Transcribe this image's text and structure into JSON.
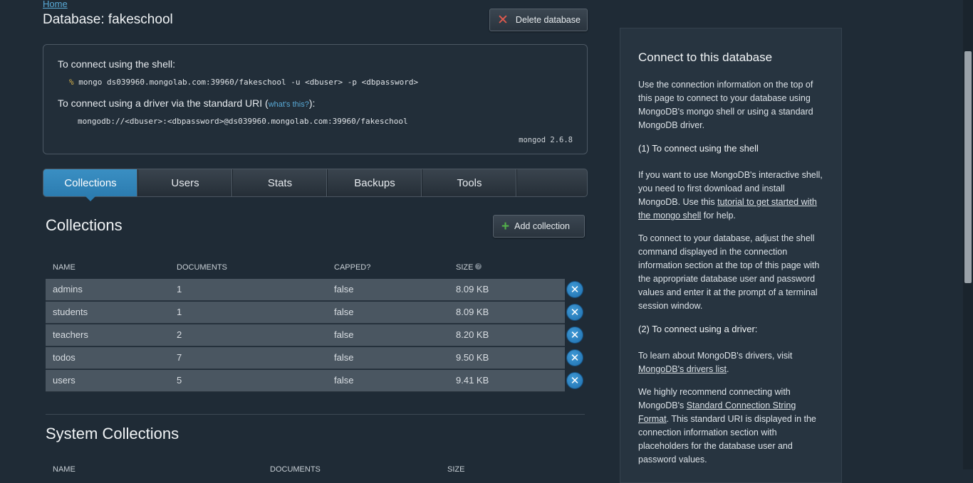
{
  "breadcrumb": {
    "home": "Home"
  },
  "page_title": "Database: fakeschool",
  "delete_database": {
    "label": "Delete database"
  },
  "connect_box": {
    "shell_heading": "To connect using the shell:",
    "shell_prompt": "%",
    "shell_command": "mongo ds039960.mongolab.com:39960/fakeschool -u <dbuser> -p <dbpassword>",
    "driver_heading_pre": "To connect using a driver via the standard URI (",
    "driver_link": "what's this?",
    "driver_heading_post": "):",
    "uri": "mongodb://<dbuser>:<dbpassword>@ds039960.mongolab.com:39960/fakeschool",
    "version": "mongod 2.6.8"
  },
  "tabs": [
    "Collections",
    "Users",
    "Stats",
    "Backups",
    "Tools"
  ],
  "active_tab": "Collections",
  "collections": {
    "heading": "Collections",
    "add_label": "Add collection",
    "columns": {
      "name": "NAME",
      "documents": "DOCUMENTS",
      "capped": "CAPPED?",
      "size": "SIZE"
    },
    "rows": [
      {
        "name": "admins",
        "documents": "1",
        "capped": "false",
        "size": "8.09 KB"
      },
      {
        "name": "students",
        "documents": "1",
        "capped": "false",
        "size": "8.09 KB"
      },
      {
        "name": "teachers",
        "documents": "2",
        "capped": "false",
        "size": "8.20 KB"
      },
      {
        "name": "todos",
        "documents": "7",
        "capped": "false",
        "size": "9.50 KB"
      },
      {
        "name": "users",
        "documents": "5",
        "capped": "false",
        "size": "9.41 KB"
      }
    ]
  },
  "system_collections": {
    "heading": "System Collections",
    "columns": {
      "name": "NAME",
      "documents": "DOCUMENTS",
      "size": "SIZE"
    }
  },
  "help_panel": {
    "title": "Connect to this database",
    "intro_pre": "Use the connection information on the top of this page to connect to your database using MongoDB's ",
    "intro_code": "mongo",
    "intro_post": " shell or using a standard MongoDB driver.",
    "shell_heading": "(1) To connect using the shell",
    "shell_p1_pre": "If you want to use MongoDB's interactive shell, you need to first download and install MongoDB. Use this ",
    "shell_p1_link": "tutorial to get started with the mongo shell",
    "shell_p1_post": " for help.",
    "shell_p2": "To connect to your database, adjust the shell command displayed in the connection information section at the top of this page with the appropriate database user and password values and enter it at the prompt of a terminal session window.",
    "driver_heading": "(2) To connect using a driver:",
    "driver_p1_pre": "To learn about MongoDB's drivers, visit ",
    "driver_p1_link": "MongoDB's drivers list",
    "driver_p1_post": ".",
    "driver_p2_pre": "We highly recommend connecting with MongoDB's ",
    "driver_p2_link": "Standard Connection String Format",
    "driver_p2_post": ". This standard URI is displayed in the connection information section with placeholders for the database user and password values."
  },
  "colors": {
    "background": "#1f2b36",
    "accent": "#2c7cb0",
    "delete_icon": "#e25a4e",
    "add_icon": "#52b04a"
  }
}
